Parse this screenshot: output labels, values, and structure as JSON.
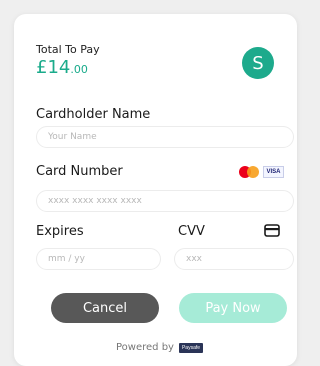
{
  "summary": {
    "total_label": "Total To Pay",
    "amount_main": "£14",
    "amount_pence": ".00",
    "avatar_letter": "S"
  },
  "form": {
    "cardholder_label": "Cardholder Name",
    "cardholder_placeholder": "Your Name",
    "card_number_label": "Card Number",
    "card_number_placeholder": "xxxx xxxx xxxx xxxx",
    "expires_label": "Expires",
    "expires_placeholder": "mm / yy",
    "cvv_label": "CVV",
    "cvv_placeholder": "xxx",
    "card_brands": [
      "mastercard-logo",
      "visa-logo"
    ],
    "visa_text": "VISA"
  },
  "actions": {
    "cancel_label": "Cancel",
    "pay_label": "Pay Now"
  },
  "footer": {
    "powered_by": "Powered by",
    "brand": "Paysafe"
  },
  "colors": {
    "accent": "#1daa8c",
    "cancel_bg": "#585858",
    "pay_bg_disabled": "#a6ebd7"
  }
}
